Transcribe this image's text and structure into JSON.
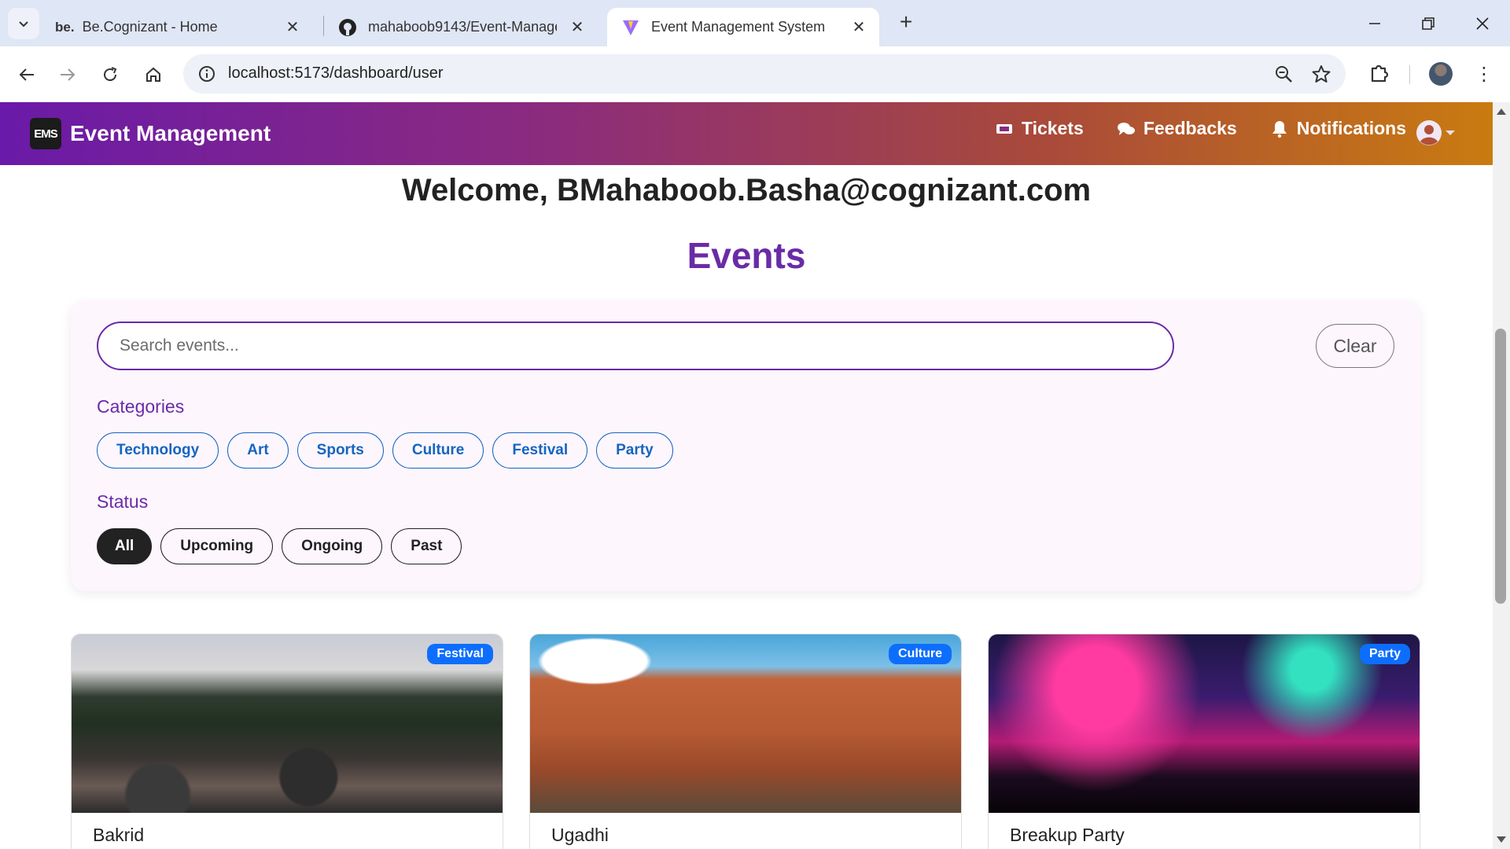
{
  "browser": {
    "tabs": [
      {
        "label": "Be.Cognizant - Home",
        "favicon": "be."
      },
      {
        "label": "mahaboob9143/Event-Manage"
      },
      {
        "label": "Event Management System"
      }
    ],
    "url": "localhost:5173/dashboard/user"
  },
  "app": {
    "brand_logo": "EMS",
    "brand_name": "Event Management",
    "nav": {
      "tickets": "Tickets",
      "feedbacks": "Feedbacks",
      "notifications": "Notifications"
    },
    "colors": {
      "nav_start": "#6a1aa8",
      "nav_end": "#c97b10",
      "accent": "#6a2ba6",
      "pill_blue": "#1565c0",
      "badge": "#0d6efd"
    }
  },
  "main": {
    "welcome": "Welcome, BMahaboob.Basha@cognizant.com",
    "heading": "Events",
    "search": {
      "placeholder": "Search events...",
      "value": ""
    },
    "clear_label": "Clear",
    "categories_label": "Categories",
    "categories": [
      "Technology",
      "Art",
      "Sports",
      "Culture",
      "Festival",
      "Party"
    ],
    "status_label": "Status",
    "statuses": [
      "All",
      "Upcoming",
      "Ongoing",
      "Past"
    ],
    "active_status": "All",
    "events": [
      {
        "title": "Bakrid",
        "badge": "Festival"
      },
      {
        "title": "Ugadhi",
        "badge": "Culture"
      },
      {
        "title": "Breakup Party",
        "badge": "Party"
      }
    ]
  }
}
